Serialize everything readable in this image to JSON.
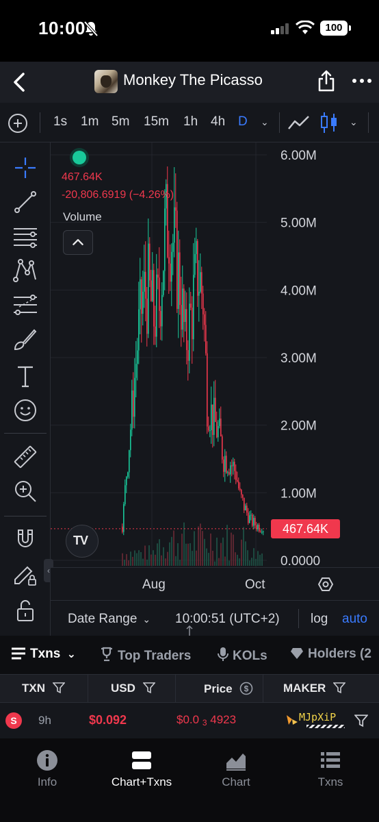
{
  "status_bar": {
    "time": "10:00",
    "battery": "100"
  },
  "header": {
    "title": "Monkey The Picasso"
  },
  "timeframes": [
    "1s",
    "1m",
    "5m",
    "15m",
    "1h",
    "4h",
    "D"
  ],
  "active_timeframe": "D",
  "chart_legend": {
    "price": "467.64K",
    "change": "-20,806.6919 (−4.26%)",
    "volume_label": "Volume"
  },
  "chart_data": {
    "type": "candlestick",
    "y_ticks": [
      "6.00M",
      "5.00M",
      "4.00M",
      "3.00M",
      "2.00M",
      "1.00M",
      "0.0000"
    ],
    "x_ticks": [
      "Aug",
      "Oct"
    ],
    "ylim": [
      0,
      6000000
    ],
    "last_price_label": "467.64K",
    "last_price": 467640,
    "grid": true
  },
  "chart_footer": {
    "date_range": "Date Range",
    "clock": "10:00:51 (UTC+2)",
    "log": "log",
    "auto": "auto"
  },
  "tabs": [
    {
      "label": "Txns",
      "icon": "list-icon"
    },
    {
      "label": "Top Traders",
      "icon": "trophy-icon"
    },
    {
      "label": "KOLs",
      "icon": "mic-icon"
    },
    {
      "label": "Holders (2",
      "icon": "diamond-icon"
    }
  ],
  "table": {
    "columns": [
      "TXN",
      "USD",
      "Price",
      "MAKER"
    ],
    "rows": [
      {
        "type": "S",
        "age": "9h",
        "usd": "$0.092",
        "price_prefix": "$0.0",
        "price_zeros": "3",
        "price_digits": "4923",
        "maker": "MJpXiP"
      }
    ]
  },
  "bottom_nav": [
    {
      "label": "Info",
      "icon": "info-icon"
    },
    {
      "label": "Chart+Txns",
      "icon": "split-view-icon"
    },
    {
      "label": "Chart",
      "icon": "chart-icon"
    },
    {
      "label": "Txns",
      "icon": "list-icon"
    }
  ],
  "colors": {
    "up": "#19c99a",
    "down": "#f0384d",
    "accent": "#3a7bff",
    "background": "#15171c"
  }
}
